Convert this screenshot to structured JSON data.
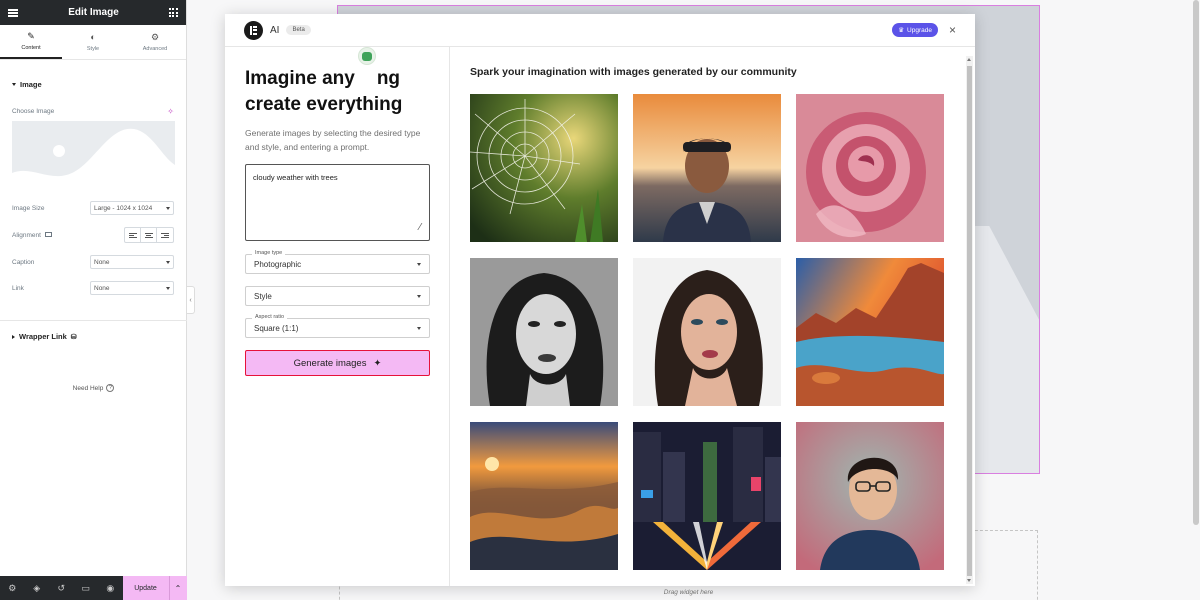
{
  "editor": {
    "title": "Edit Image",
    "tabs": [
      {
        "label": "Content",
        "icon": "pencil-icon"
      },
      {
        "label": "Style",
        "icon": "half-circle-icon"
      },
      {
        "label": "Advanced",
        "icon": "gear-icon"
      }
    ],
    "image_section": "Image",
    "choose_image": "Choose Image",
    "image_size_label": "Image Size",
    "image_size_value": "Large - 1024 x 1024",
    "alignment_label": "Alignment",
    "caption_label": "Caption",
    "caption_value": "None",
    "link_label": "Link",
    "link_value": "None",
    "wrapper_link": "Wrapper Link",
    "need_help": "Need Help",
    "update": "Update",
    "collapse_glyph": "‹"
  },
  "canvas": {
    "drag_label": "Drag widget here"
  },
  "ai_modal": {
    "brand": "AI",
    "badge": "Beta",
    "upgrade": "Upgrade",
    "headline_line1": "Imagine any",
    "headline_line1b": "ng",
    "headline_line2": "create everything",
    "subcopy": "Generate images by selecting the desired type and style, and entering a prompt.",
    "prompt": "cloudy weather with trees",
    "image_type_label": "Image type",
    "image_type_value": "Photographic",
    "style_value": "Style",
    "aspect_ratio_label": "Aspect ratio",
    "aspect_ratio_value": "Square (1:1)",
    "generate_button": "Generate images",
    "community_title": "Spark your imagination with images generated by our community",
    "gallery": [
      "spider-web-dewdrops",
      "elderly-man-sunset",
      "pink-rose",
      "woman-black-white",
      "woman-portrait-color",
      "canyon-lake-sunset",
      "mountain-dunes-sunset",
      "city-night-light-trails",
      "young-man-glasses"
    ]
  },
  "colors": {
    "accent_pink": "#f4b9f4",
    "upgrade_purple": "#5b53e8",
    "dark_bar": "#26292c"
  }
}
